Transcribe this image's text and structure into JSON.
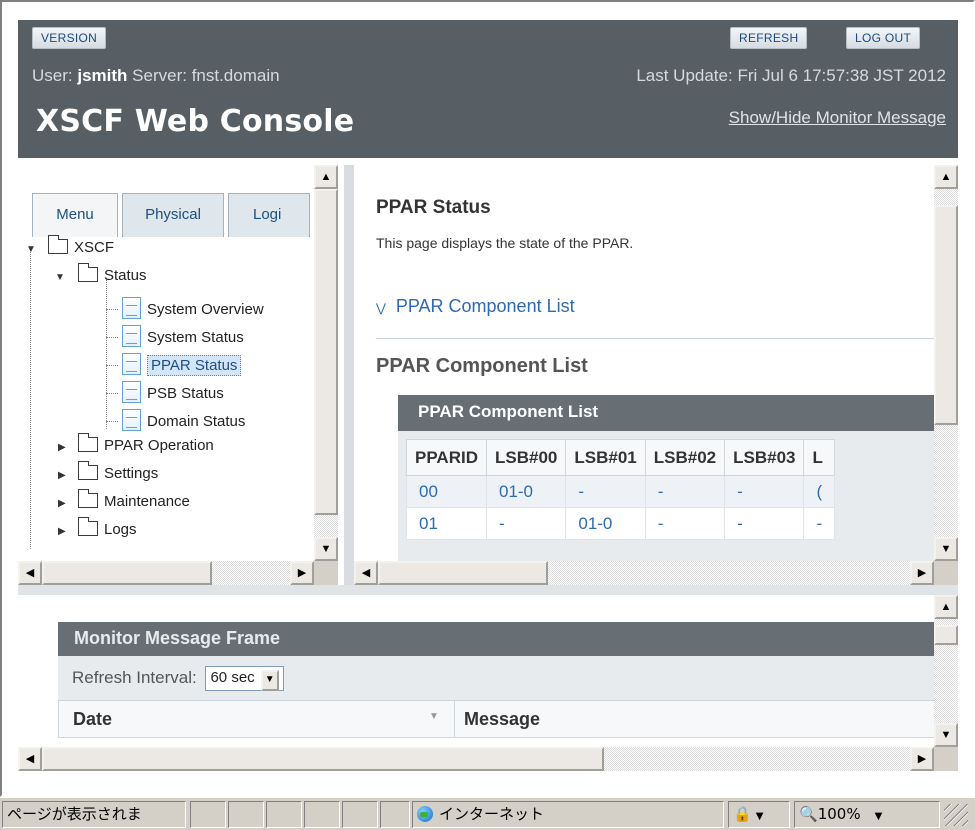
{
  "header": {
    "version_label": "VERSION",
    "refresh_label": "REFRESH",
    "logout_label": "LOG OUT",
    "user_prefix": "User:",
    "user_name": "jsmith",
    "server_prefix": "Server:",
    "server_name": "fnst.domain",
    "last_update_prefix": "Last Update:",
    "last_update_value": "Fri Jul 6 17:57:38 JST 2012",
    "app_title": "XSCF Web Console",
    "monitor_toggle_link": "Show/Hide Monitor Message"
  },
  "left_pane": {
    "tabs": [
      {
        "label": "Menu"
      },
      {
        "label": "Physical"
      },
      {
        "label": "Logi"
      }
    ],
    "tree": {
      "root": "XSCF",
      "status_folder": "Status",
      "status_items": [
        "System Overview",
        "System Status",
        "PPAR Status",
        "PSB Status",
        "Domain Status"
      ],
      "selected_item": "PPAR Status",
      "folders": [
        "PPAR Operation",
        "Settings",
        "Maintenance",
        "Logs"
      ]
    }
  },
  "main": {
    "page_title": "PPAR Status",
    "description": "This page displays the state of the PPAR.",
    "jump_link": "PPAR Component List",
    "section_title": "PPAR Component List",
    "table": {
      "title": "PPAR Component List",
      "columns": [
        "PPARID",
        "LSB#00",
        "LSB#01",
        "LSB#02",
        "LSB#03",
        "L"
      ],
      "rows": [
        [
          "00",
          "01-0",
          "-",
          "-",
          "-",
          "("
        ],
        [
          "01",
          "-",
          "01-0",
          "-",
          "-",
          "-"
        ]
      ]
    }
  },
  "monitor": {
    "title": "Monitor Message Frame",
    "refresh_label": "Refresh Interval:",
    "refresh_value": "60 sec",
    "col_date": "Date",
    "col_message": "Message"
  },
  "statusbar": {
    "status_text": "ページが表示されま",
    "zone_text": "インターネット",
    "zoom_text": "100%"
  },
  "colors": {
    "header_bg": "#585f64",
    "link_blue": "#2e6ab0",
    "table_title_bg": "#676f75"
  }
}
